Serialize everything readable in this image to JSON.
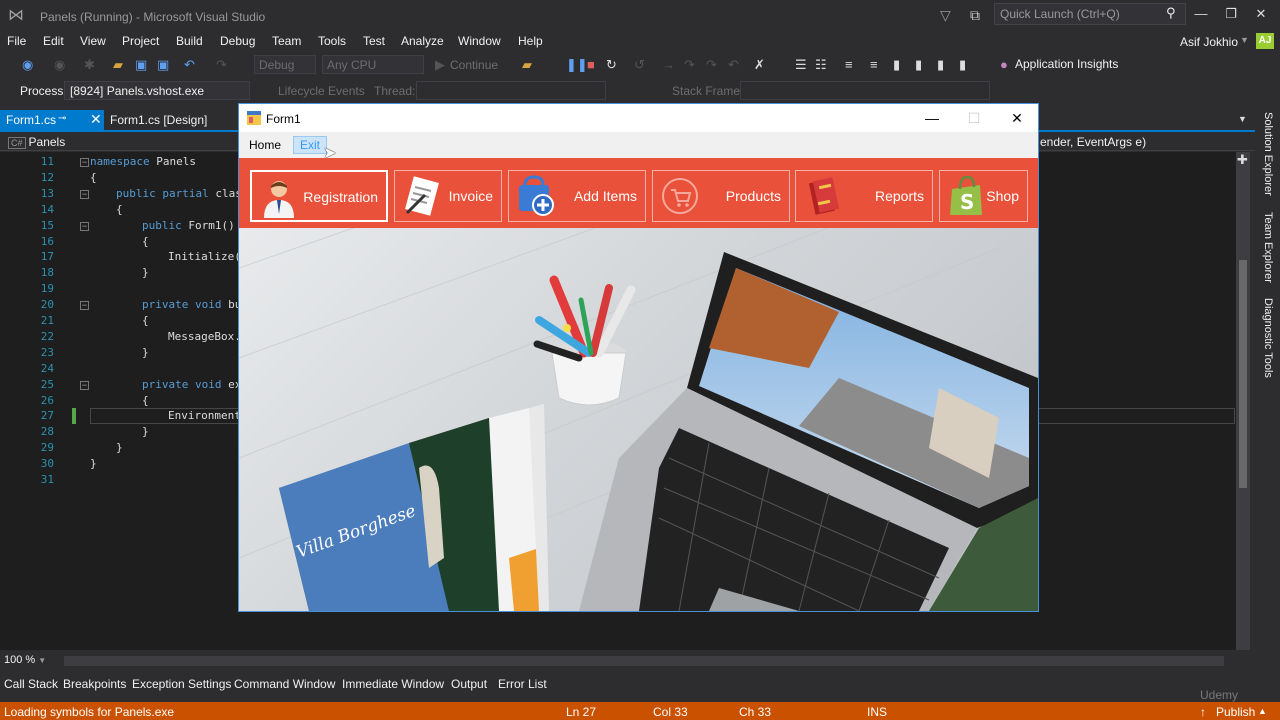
{
  "window": {
    "title": "Panels (Running) - Microsoft Visual Studio",
    "quick_launch_placeholder": "Quick Launch (Ctrl+Q)"
  },
  "menu": [
    "File",
    "Edit",
    "View",
    "Project",
    "Build",
    "Debug",
    "Team",
    "Tools",
    "Test",
    "Analyze",
    "Window",
    "Help"
  ],
  "user": {
    "name": "Asif Jokhio",
    "initials": "AJ"
  },
  "toolbar": {
    "config": "Debug",
    "platform": "Any CPU",
    "continue_label": "Continue",
    "app_insights": "Application Insights"
  },
  "debug_location": {
    "process_label": "Process:",
    "process_value": "[8924] Panels.vshost.exe",
    "lifecycle_label": "Lifecycle Events",
    "thread_label": "Thread:",
    "stackframe_label": "Stack Frame:"
  },
  "tabs": {
    "active": "Form1.cs",
    "design": "Form1.cs [Design]"
  },
  "navbar": {
    "class_scope": "Panels",
    "member_scope": "ender, EventArgs e)"
  },
  "code_lines": [
    {
      "n": "11",
      "text": "namespace Panels"
    },
    {
      "n": "12",
      "text": "{"
    },
    {
      "n": "13",
      "text": "public partial clas"
    },
    {
      "n": "14",
      "text": "{"
    },
    {
      "n": "15",
      "text": "public Form1()"
    },
    {
      "n": "16",
      "text": "{"
    },
    {
      "n": "17",
      "text": "Initialize("
    },
    {
      "n": "18",
      "text": "}"
    },
    {
      "n": "19",
      "text": ""
    },
    {
      "n": "20",
      "text": "private void bu"
    },
    {
      "n": "21",
      "text": "{"
    },
    {
      "n": "22",
      "text": "MessageBox."
    },
    {
      "n": "23",
      "text": "}"
    },
    {
      "n": "24",
      "text": ""
    },
    {
      "n": "25",
      "text": "private void ex"
    },
    {
      "n": "26",
      "text": "{"
    },
    {
      "n": "27",
      "text": "Environment"
    },
    {
      "n": "28",
      "text": "}"
    },
    {
      "n": "29",
      "text": "}"
    },
    {
      "n": "30",
      "text": "}"
    },
    {
      "n": "31",
      "text": ""
    }
  ],
  "side_panels": [
    "Solution Explorer",
    "Team Explorer",
    "Diagnostic Tools"
  ],
  "zoom": "100 %",
  "bottom_tabs": [
    "Call Stack",
    "Breakpoints",
    "Exception Settings",
    "Command Window",
    "Immediate Window",
    "Output",
    "Error List"
  ],
  "status": {
    "message": "Loading symbols for Panels.exe",
    "ln": "Ln 27",
    "col": "Col 33",
    "ch": "Ch 33",
    "mode": "INS",
    "publish": "Publish",
    "watermark": "Udemy"
  },
  "form1": {
    "title": "Form1",
    "menu": {
      "home": "Home",
      "exit": "Exit"
    },
    "buttons": [
      "Registration",
      "Invoice",
      "Add Items",
      "Products",
      "Reports",
      "Shop"
    ],
    "magazine_text": "Villa Borghese",
    "colors": {
      "panel": "#e9513a",
      "accent": "#007acc",
      "status": "#ca5100"
    }
  }
}
